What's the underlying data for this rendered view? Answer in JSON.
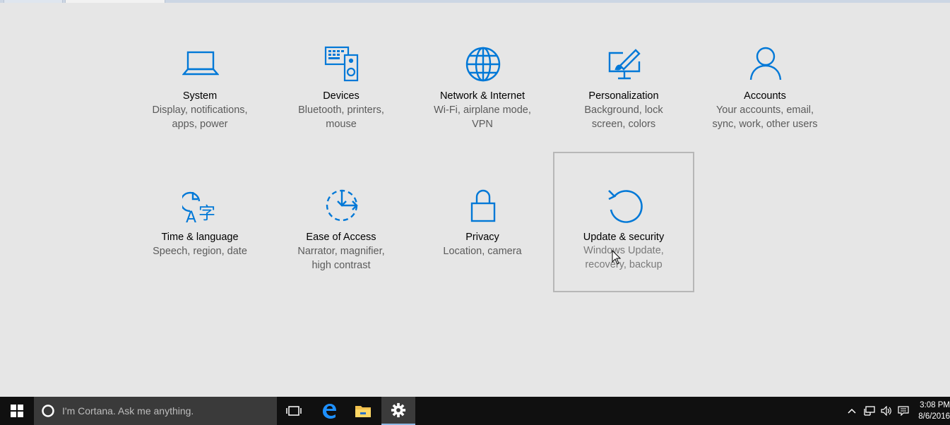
{
  "settings_tiles": [
    {
      "title": "System",
      "desc_line1": "Display, notifications,",
      "desc_line2": "apps, power",
      "icon": "laptop-icon"
    },
    {
      "title": "Devices",
      "desc_line1": "Bluetooth, printers,",
      "desc_line2": "mouse",
      "icon": "devices-icon"
    },
    {
      "title": "Network & Internet",
      "desc_line1": "Wi-Fi, airplane mode,",
      "desc_line2": "VPN",
      "icon": "globe-icon"
    },
    {
      "title": "Personalization",
      "desc_line1": "Background, lock",
      "desc_line2": "screen, colors",
      "icon": "personalization-icon"
    },
    {
      "title": "Accounts",
      "desc_line1": "Your accounts, email,",
      "desc_line2": "sync, work, other users",
      "icon": "person-icon"
    },
    {
      "title": "Time & language",
      "desc_line1": "Speech, region, date",
      "desc_line2": "",
      "icon": "time-language-icon"
    },
    {
      "title": "Ease of Access",
      "desc_line1": "Narrator, magnifier,",
      "desc_line2": "high contrast",
      "icon": "ease-of-access-icon"
    },
    {
      "title": "Privacy",
      "desc_line1": "Location, camera",
      "desc_line2": "",
      "icon": "lock-icon"
    },
    {
      "title": "Update & security",
      "desc_line1": "Windows Update,",
      "desc_line2": "recovery, backup",
      "icon": "refresh-icon"
    }
  ],
  "selected_tile": "Update & security",
  "accent_color": "#0078d7",
  "taskbar": {
    "search_placeholder": "I'm Cortana. Ask me anything.",
    "pinned": [
      "task-view-icon",
      "edge-icon",
      "file-explorer-icon",
      "settings-gear-icon"
    ],
    "active_app": "settings-gear-icon",
    "clock_time": "3:08 PM",
    "clock_date": "8/6/2016"
  }
}
